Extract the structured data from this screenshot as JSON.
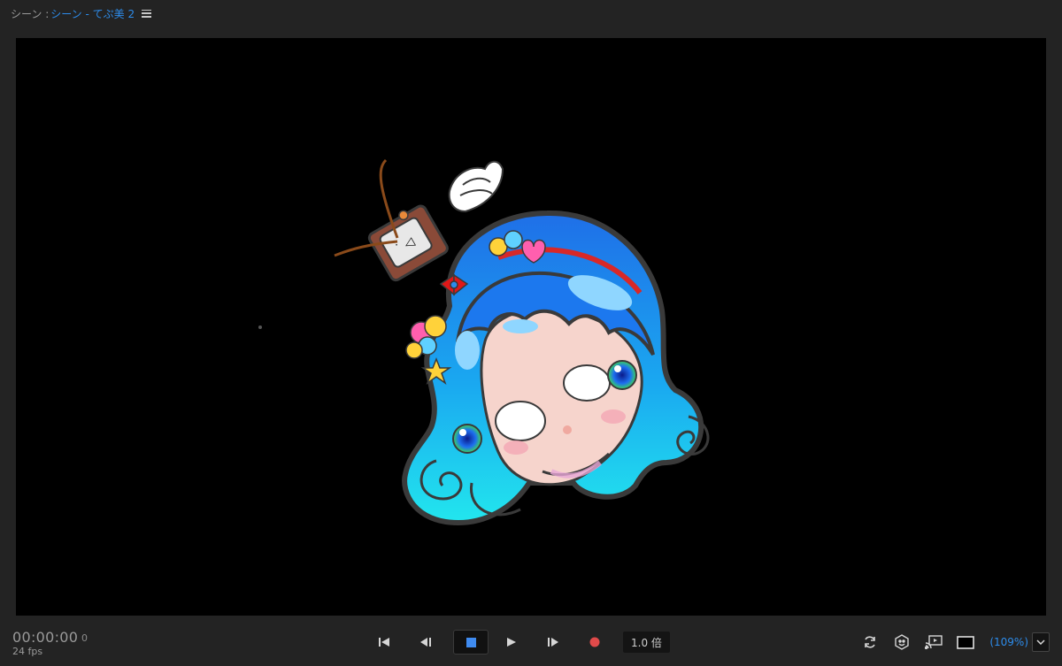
{
  "header": {
    "scene_label": "シーン :",
    "scene_name": "シーン - てぷ美 2",
    "menu_icon": "hamburger-menu-icon"
  },
  "footer": {
    "timecode": "00:00:00",
    "frame": "0",
    "fps": "24 fps",
    "speed": "1.0 倍",
    "zoom": "(109%)"
  },
  "transport_icons": [
    "go-to-start-icon",
    "step-back-icon",
    "stop-icon",
    "play-icon",
    "step-forward-icon",
    "record-icon"
  ],
  "tool_icons": [
    "refresh-icon",
    "character-view-icon",
    "cast-icon",
    "frame-icon",
    "chevron-down-icon"
  ],
  "colors": {
    "background": "#232323",
    "canvas": "#000000",
    "accent": "#2d8ceb",
    "record": "#e04a4a",
    "stop": "#3f8bf0"
  }
}
